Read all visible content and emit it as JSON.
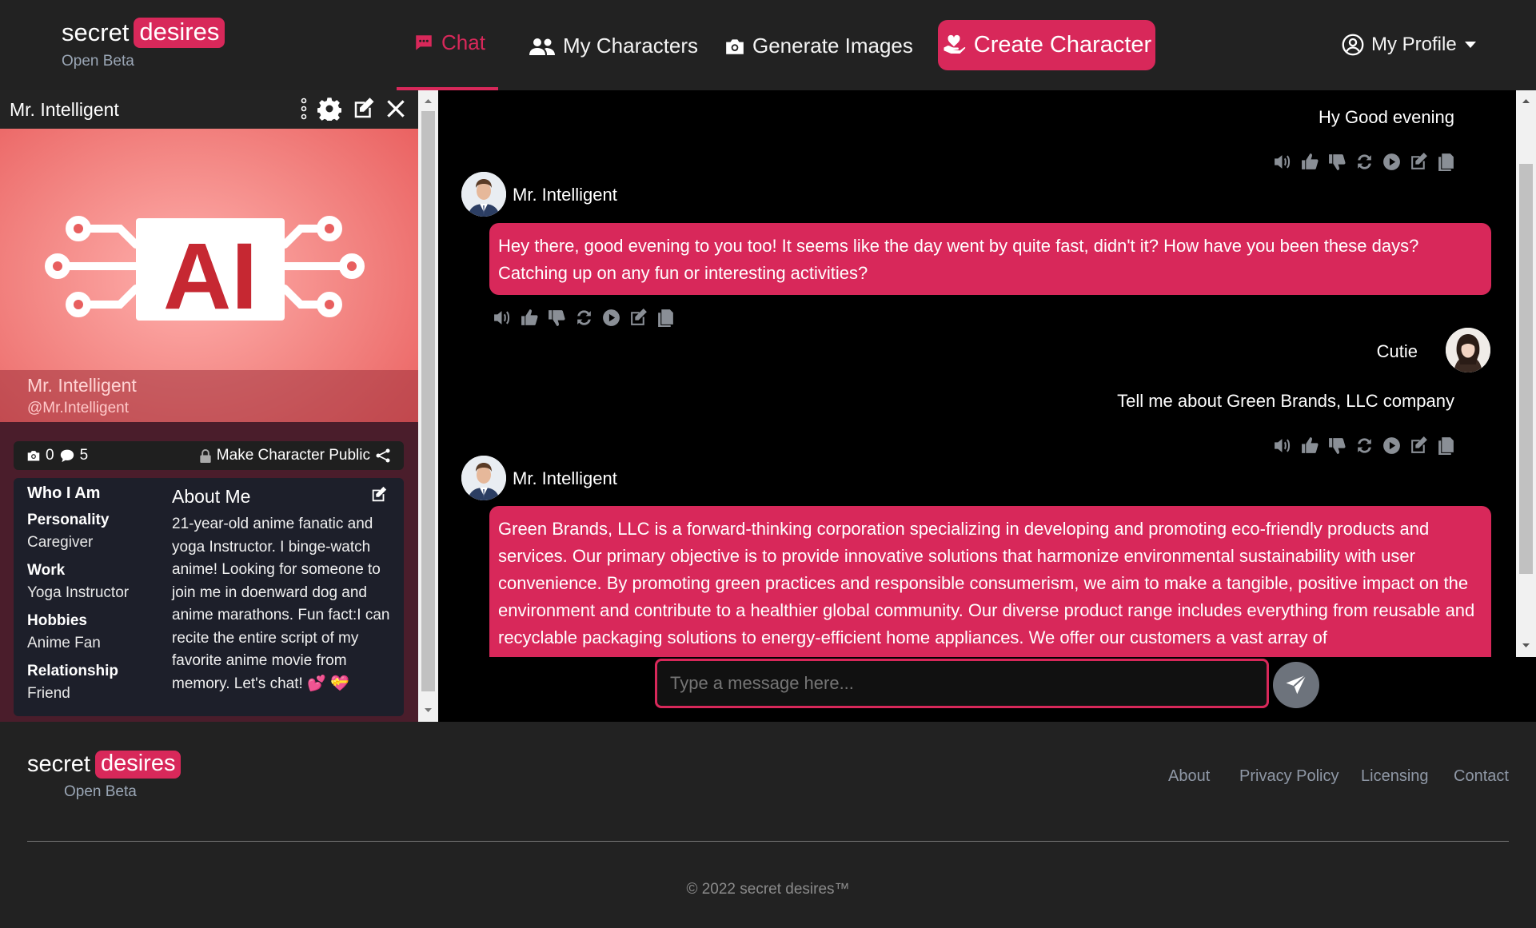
{
  "brand": {
    "secret": "secret",
    "desires": "desires",
    "beta": "Open Beta"
  },
  "nav": {
    "chat": "Chat",
    "my_characters": "My Characters",
    "generate_images": "Generate Images",
    "create_character": "Create Character",
    "my_profile": "My Profile"
  },
  "side": {
    "title": "Mr. Intelligent",
    "hero_name": "Mr. Intelligent",
    "hero_handle": "@Mr.Intelligent",
    "hero_logo_text": "AI",
    "stats": {
      "images": "0",
      "messages": "5",
      "make_public": "Make Character Public"
    },
    "who_i_am": "Who I Am",
    "attributes": [
      {
        "label": "Personality",
        "value": "Caregiver"
      },
      {
        "label": "Work",
        "value": "Yoga Instructor"
      },
      {
        "label": "Hobbies",
        "value": "Anime Fan"
      },
      {
        "label": "Relationship",
        "value": "Friend"
      }
    ],
    "about_title": "About Me",
    "about_text": "21-year-old anime fanatic and yoga Instructor. I binge-watch anime! Looking for someone to join me in doenward dog and anime marathons. Fun fact:I can recite the entire script of my favorite anime movie from memory. Let's chat! 💕 💝"
  },
  "chat": {
    "messages": [
      {
        "sender": "user",
        "text": "Hy Good evening"
      },
      {
        "sender": "Mr. Intelligent",
        "text": "Hey there, good evening to you too! It seems like the day went by quite fast, didn't it? How have you been these days? Catching up on any fun or interesting activities?"
      },
      {
        "sender": "Cutie",
        "text": "Tell me about Green Brands, LLC company"
      },
      {
        "sender": "Mr. Intelligent",
        "text": "Green Brands, LLC is a forward-thinking corporation specializing in developing and promoting eco-friendly products and services. Our primary objective is to provide innovative solutions that harmonize environmental sustainability with user convenience. By promoting green practices and responsible consumerism, we aim to make a tangible, positive impact on the environment and contribute to a healthier global community. Our diverse product range includes everything from reusable and recyclable packaging solutions to energy-efficient home appliances. We offer our customers a vast array of"
      }
    ],
    "input_placeholder": "Type a message here..."
  },
  "footer": {
    "links": [
      "About",
      "Privacy Policy",
      "Licensing",
      "Contact"
    ],
    "copyright": "© 2022 secret desires™"
  },
  "colors": {
    "accent": "#d8285a",
    "background": "#222222",
    "chat_bg": "#000000"
  },
  "icons": [
    "chat-icon",
    "users-icon",
    "camera-icon",
    "heart-hand-icon",
    "user-circle-icon",
    "caret-down-icon",
    "kebab-icon",
    "gear-icon",
    "edit-icon",
    "close-icon",
    "lock-icon",
    "share-icon",
    "send-icon",
    "speaker-icon",
    "thumbs-up-icon",
    "thumbs-down-icon",
    "refresh-icon",
    "play-icon",
    "copy-icon"
  ]
}
